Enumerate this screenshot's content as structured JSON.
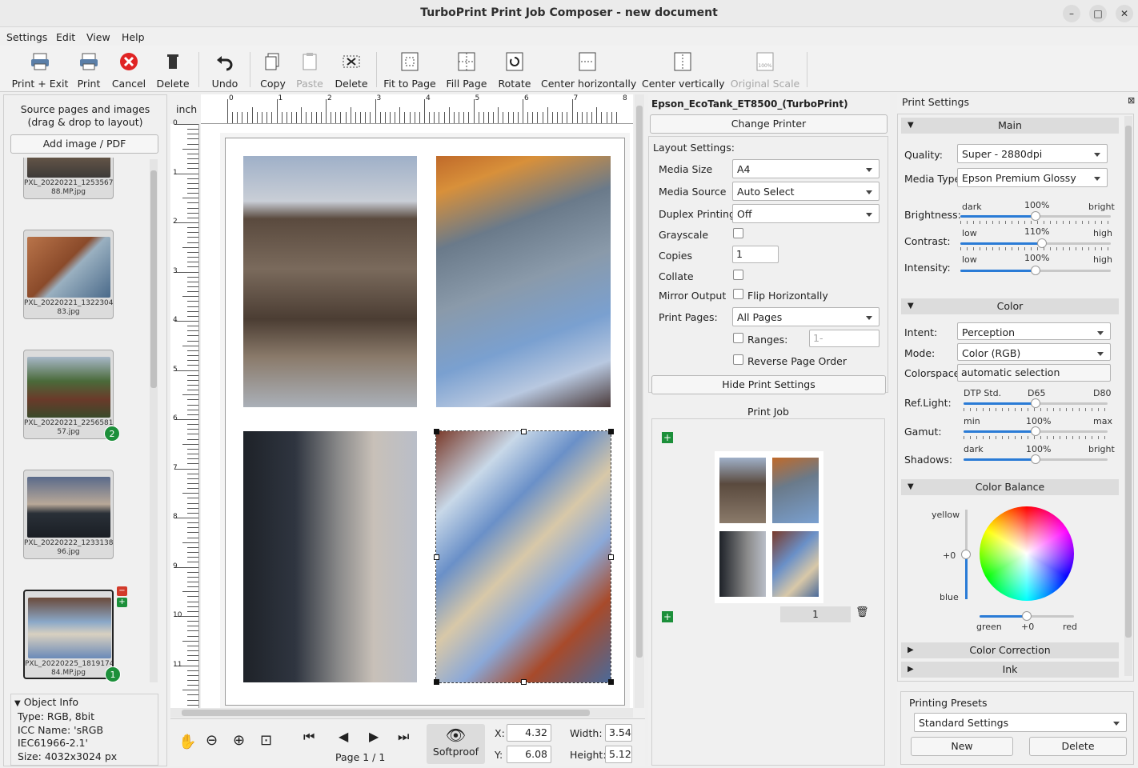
{
  "window": {
    "title": "TurboPrint Print Job Composer - new document"
  },
  "menu": [
    "Settings",
    "Edit",
    "View",
    "Help"
  ],
  "toolbar": [
    {
      "label": "Print + Exit",
      "icon": "printer-exit-icon"
    },
    {
      "label": "Print",
      "icon": "printer-icon"
    },
    {
      "label": "Cancel",
      "icon": "cancel-icon"
    },
    {
      "label": "Delete",
      "icon": "trash-icon"
    },
    {
      "label": "Undo",
      "icon": "undo-icon"
    },
    {
      "label": "Copy",
      "icon": "copy-icon"
    },
    {
      "label": "Paste",
      "icon": "paste-icon",
      "disabled": true
    },
    {
      "label": "Delete",
      "icon": "delete-selection-icon"
    },
    {
      "label": "Fit to Page",
      "icon": "fit-page-icon"
    },
    {
      "label": "Fill Page",
      "icon": "fill-page-icon"
    },
    {
      "label": "Rotate",
      "icon": "rotate-icon"
    },
    {
      "label": "Center horizontally",
      "icon": "center-h-icon"
    },
    {
      "label": "Center vertically",
      "icon": "center-v-icon"
    },
    {
      "label": "Original Scale",
      "icon": "original-scale-icon",
      "disabled": true
    }
  ],
  "source": {
    "header1": "Source pages and images",
    "header2": "(drag & drop to layout)",
    "add_button": "Add image / PDF",
    "thumbs": [
      {
        "caption1": "PXL_20220221_1253567",
        "caption2": "88.MP.jpg",
        "badge": ""
      },
      {
        "caption1": "PXL_20220221_1322304",
        "caption2": "83.jpg",
        "badge": ""
      },
      {
        "caption1": "PXL_20220221_2256581",
        "caption2": "57.jpg",
        "badge": "2"
      },
      {
        "caption1": "PXL_20220222_1233138",
        "caption2": "96.jpg",
        "badge": ""
      },
      {
        "caption1": "PXL_20220225_1819174",
        "caption2": "84.MP.jpg",
        "badge": "1"
      }
    ]
  },
  "object_info": {
    "title": "Object Info",
    "type": "Type: RGB, 8bit",
    "icc1": "ICC Name: 'sRGB",
    "icc2": "IEC61966-2.1'",
    "size": "Size: 4032x3024 px"
  },
  "ruler": {
    "unit": "inch",
    "h_ticks": [
      "0",
      "1",
      "2",
      "3",
      "4",
      "5",
      "6",
      "7",
      "8"
    ],
    "v_ticks": [
      "0",
      "1",
      "2",
      "3",
      "4",
      "5",
      "6",
      "7",
      "8",
      "9",
      "10",
      "11"
    ]
  },
  "bottom": {
    "page": "Page 1 / 1",
    "softproof": "Softproof",
    "x_label": "X:",
    "x_value": "4.32",
    "y_label": "Y:",
    "y_value": "6.08",
    "w_label": "Width:",
    "w_value": "3.54",
    "h_label": "Height:",
    "h_value": "5.12"
  },
  "printer": {
    "name": "Epson_EcoTank_ET8500_(TurboPrint)",
    "change": "Change Printer",
    "layout_title": "Layout Settings:",
    "media_size_label": "Media Size",
    "media_size": "A4",
    "media_source_label": "Media Source",
    "media_source": "Auto Select",
    "duplex_label": "Duplex Printing",
    "duplex": "Off",
    "grayscale_label": "Grayscale",
    "copies_label": "Copies",
    "copies": "1",
    "collate_label": "Collate",
    "mirror_label": "Mirror Output",
    "flip_label": "Flip Horizontally",
    "pages_label": "Print Pages:",
    "pages": "All Pages",
    "ranges_label": "Ranges:",
    "ranges_placeholder": "1-",
    "reverse_label": "Reverse Page Order",
    "hide": "Hide Print Settings",
    "job_title": "Print Job",
    "job_page": "1"
  },
  "settings": {
    "title": "Print Settings",
    "main": "Main",
    "quality_label": "Quality:",
    "quality": "Super - 2880dpi",
    "media_type_label": "Media Type:",
    "media_type": "Epson Premium Glossy",
    "brightness_label": "Brightness:",
    "brightness_min": "dark",
    "brightness_val": "100%",
    "brightness_max": "bright",
    "contrast_label": "Contrast:",
    "contrast_min": "low",
    "contrast_val": "110%",
    "contrast_max": "high",
    "intensity_label": "Intensity:",
    "intensity_min": "low",
    "intensity_val": "100%",
    "intensity_max": "high",
    "color": "Color",
    "intent_label": "Intent:",
    "intent": "Perception",
    "mode_label": "Mode:",
    "mode": "Color (RGB)",
    "colorspace_label": "Colorspace:",
    "colorspace": "automatic selection",
    "reflight_label": "Ref.Light:",
    "reflight_min": "DTP Std.",
    "reflight_val": "D65",
    "reflight_max": "D80",
    "gamut_label": "Gamut:",
    "gamut_min": "min",
    "gamut_val": "100%",
    "gamut_max": "max",
    "shadows_label": "Shadows:",
    "shadows_min": "dark",
    "shadows_val": "100%",
    "shadows_max": "bright",
    "color_balance": "Color Balance",
    "cb_yellow": "yellow",
    "cb_zero": "+0",
    "cb_blue": "blue",
    "cb_green": "green",
    "cb_zero2": "+0",
    "cb_red": "red",
    "color_correction": "Color Correction",
    "ink": "Ink",
    "presets_title": "Printing Presets",
    "preset": "Standard Settings",
    "new": "New",
    "delete": "Delete"
  },
  "colors": {
    "accent": "#2a7bd6",
    "badge": "#1c8f3a"
  }
}
